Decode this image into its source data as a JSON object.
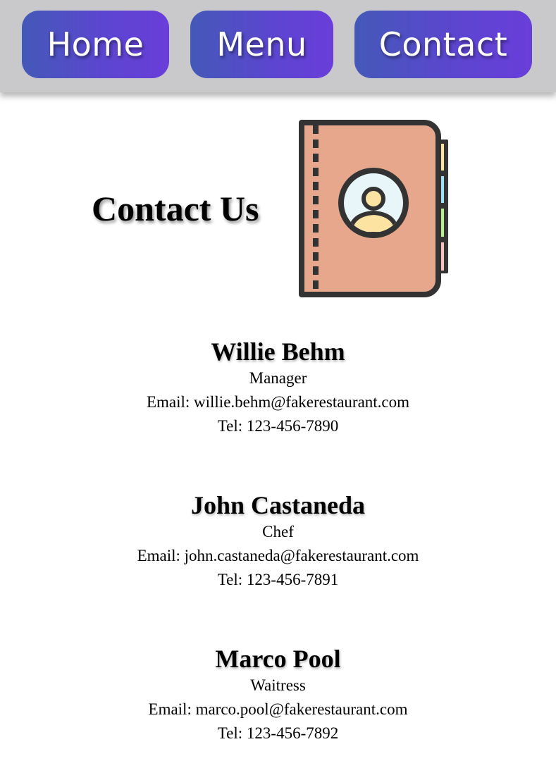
{
  "nav": {
    "home_label": "Home",
    "menu_label": "Menu",
    "contact_label": "Contact"
  },
  "page": {
    "title": "Contact Us",
    "icon": "address-book-icon"
  },
  "contacts": [
    {
      "name": "Willie Behm",
      "role": "Manager",
      "email": "Email: willie.behm@fakerestaurant.com",
      "tel": "Tel: 123-456-7890"
    },
    {
      "name": "John Castaneda",
      "role": "Chef",
      "email": "Email: john.castaneda@fakerestaurant.com",
      "tel": "Tel: 123-456-7891"
    },
    {
      "name": "Marco Pool",
      "role": "Waitress",
      "email": "Email: marco.pool@fakerestaurant.com",
      "tel": "Tel: 123-456-7892"
    }
  ],
  "colors": {
    "nav_background": "#c9c9cb",
    "button_gradient_start": "#4459b8",
    "button_gradient_end": "#6a3dda",
    "book_cover": "#e6a78c"
  }
}
